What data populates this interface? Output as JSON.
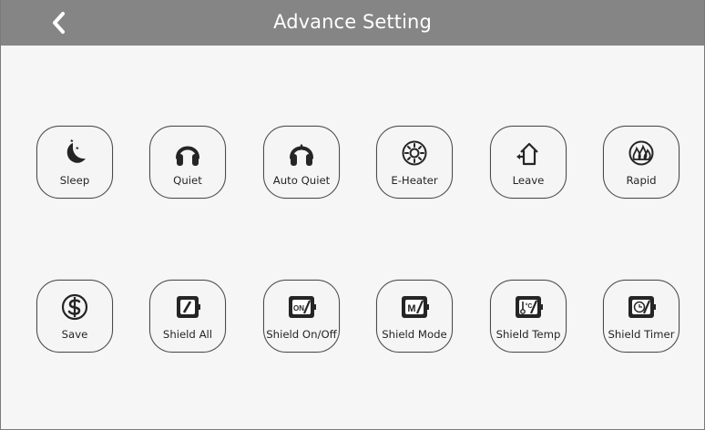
{
  "header": {
    "title": "Advance Setting",
    "back_icon": "chevron-left-icon"
  },
  "colors": {
    "header_background": "#858585",
    "page_background": "#f6f6f6",
    "button_border": "#4a4a4a",
    "icon_color": "#252525"
  },
  "settings": {
    "row1": [
      {
        "label": "Sleep",
        "icon": "moon-stars-icon"
      },
      {
        "label": "Quiet",
        "icon": "headphones-icon"
      },
      {
        "label": "Auto Quiet",
        "icon": "auto-headphones-icon"
      },
      {
        "label": "E-Heater",
        "icon": "sun-heater-icon"
      },
      {
        "label": "Leave",
        "icon": "house-leave-icon"
      },
      {
        "label": "Rapid",
        "icon": "flame-rapid-icon"
      }
    ],
    "row2": [
      {
        "label": "Save",
        "icon": "dollar-circle-icon"
      },
      {
        "label": "Shield All",
        "icon": "shield-all-icon"
      },
      {
        "label": "Shield On/Off",
        "icon": "shield-onoff-icon",
        "icon_text": "ON"
      },
      {
        "label": "Shield Mode",
        "icon": "shield-mode-icon",
        "icon_text": "M"
      },
      {
        "label": "Shield Temp",
        "icon": "shield-temp-icon",
        "icon_text": "°C"
      },
      {
        "label": "Shield Timer",
        "icon": "shield-timer-icon"
      }
    ]
  }
}
